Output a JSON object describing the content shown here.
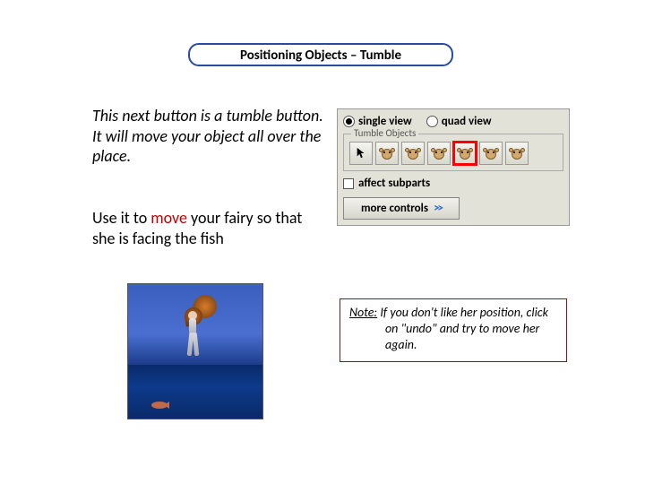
{
  "title": "Positioning Objects – Tumble",
  "paragraphs": {
    "p1": "This next button is a tumble button. It will move your object all over the place.",
    "p2_pre": "Use it to ",
    "p2_move": "move",
    "p2_post": " your fairy so that she is facing the fish"
  },
  "panel": {
    "radios": {
      "single_view": "single view",
      "quad_view": "quad view",
      "selected": "single_view"
    },
    "fieldset_legend": "Tumble Objects",
    "toolbar_buttons": [
      {
        "name": "pointer",
        "highlighted": false
      },
      {
        "name": "tumble-1",
        "highlighted": false
      },
      {
        "name": "tumble-2",
        "highlighted": false
      },
      {
        "name": "tumble-3",
        "highlighted": false
      },
      {
        "name": "tumble-4",
        "highlighted": true
      },
      {
        "name": "tumble-5",
        "highlighted": false
      },
      {
        "name": "tumble-6",
        "highlighted": false
      }
    ],
    "affect_subparts_label": "affect subparts",
    "affect_subparts_checked": false,
    "more_controls_label": "more controls",
    "more_controls_chevron": ">>"
  },
  "note": {
    "label": "Note:",
    "body": " If you don't like her position, click on \"undo\" and try to move her again."
  }
}
